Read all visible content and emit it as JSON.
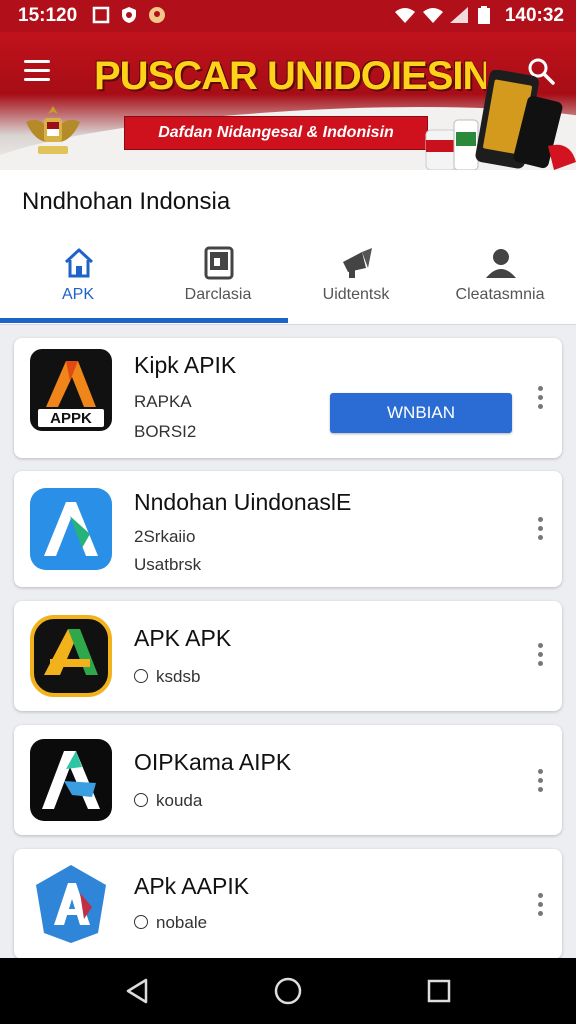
{
  "status_bar": {
    "time": "15:120",
    "clock": "140:32"
  },
  "banner": {
    "title": "PUSCAR UNIDOIESIN",
    "subtitle": "Dafdan Nidangesal & Indonisin"
  },
  "header": {
    "title": "Nndhohan Indonsia"
  },
  "tabs": [
    {
      "label": "APK",
      "icon": "home-icon",
      "active": true
    },
    {
      "label": "Darclasia",
      "icon": "tablet-icon",
      "active": false
    },
    {
      "label": "Uidtentsk",
      "icon": "megaphone-icon",
      "active": false
    },
    {
      "label": "Cleatasmnia",
      "icon": "person-icon",
      "active": false
    }
  ],
  "apps": [
    {
      "name": "Kipk APIK",
      "line1": "RAPKA",
      "line2": "BORSI2",
      "button": "WNBIAN"
    },
    {
      "name": "Nndohan UindonaslЕ",
      "line1": "2Srkaiio",
      "line2": "Usatbrsk"
    },
    {
      "name": "APK APK",
      "line1": "ksdsb"
    },
    {
      "name": "OIPKama AIPK",
      "line1": "kouda"
    },
    {
      "name": "APk AAPIK",
      "line1": "nobale"
    }
  ],
  "colors": {
    "accent": "#1e63c8",
    "brand_red": "#b1101a",
    "banner_yellow": "#ffd21a"
  }
}
